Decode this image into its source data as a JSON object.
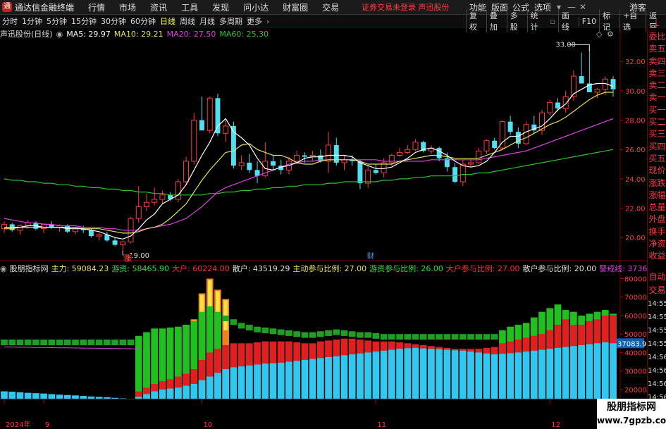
{
  "titlebar": {
    "app_name": "通达信金融终端",
    "menus": [
      "行情",
      "市场",
      "资讯",
      "工具",
      "发现",
      "问小达",
      "财富圈",
      "交易"
    ],
    "warning": "证券交易未登录  声迅股份",
    "right_menus": [
      "功能",
      "版面",
      "公式",
      "选项",
      "游客"
    ]
  },
  "toolbar": {
    "periods": [
      "分时",
      "1分钟",
      "5分钟",
      "15分钟",
      "30分钟",
      "60分钟",
      "日线",
      "周线",
      "月线",
      "多周期",
      "更多"
    ],
    "active_period": "日线",
    "right_buttons": [
      "复权",
      "叠加",
      "多股",
      "统计",
      "画线",
      "F10",
      "标记",
      "+自选",
      "返回"
    ]
  },
  "kline": {
    "stock": "声迅股份(日线)",
    "ma": [
      {
        "label": "MA5: 29.97",
        "color": "#ffffff"
      },
      {
        "label": "MA10: 29.21",
        "color": "#e8e05a"
      },
      {
        "label": "MA20: 27.50",
        "color": "#e040e0"
      },
      {
        "label": "MA60: 25.30",
        "color": "#30c030"
      }
    ],
    "price_ticks": [
      "32.00",
      "30.00",
      "28.00",
      "26.00",
      "24.00",
      "22.00",
      "20.00"
    ],
    "high_label": "33.00",
    "low_label": "19.00",
    "marker_zhang": "涨",
    "marker_cai": "财"
  },
  "indicator": {
    "name": "股朋指标网",
    "items": [
      {
        "label": "主力: 59084.23",
        "color": "#e8e05a"
      },
      {
        "label": "游资: 58465.90",
        "color": "#30e030"
      },
      {
        "label": "大户: 60224.00",
        "color": "#ff3030"
      },
      {
        "label": "散户: 43519.29",
        "color": "#dddddd"
      },
      {
        "label": "主动参与比例: 27.00",
        "color": "#e8e05a"
      },
      {
        "label": "游资参与比例: 26.00",
        "color": "#30e030"
      },
      {
        "label": "大户参与比例: 27.00",
        "color": "#ff3030"
      },
      {
        "label": "散户参与比例: 20.00",
        "color": "#dddddd"
      },
      {
        "label": "警戒线: 37367.96",
        "color": "#e040e0"
      }
    ],
    "value_ticks": [
      "80000",
      "70000",
      "60000",
      "50000",
      "40000",
      "30000",
      "20000"
    ],
    "current_value": "37083.96"
  },
  "time_axis": [
    "2024年",
    "9",
    "10",
    "11",
    "12"
  ],
  "right_panel": {
    "top_labels": [
      "委比",
      "卖五",
      "卖四",
      "卖三",
      "卖二",
      "卖一",
      "买一",
      "买二",
      "买三",
      "买四",
      "买五",
      "现价",
      "涨跌",
      "涨幅",
      "总量",
      "外盘",
      "换手",
      "净资",
      "收益"
    ],
    "bottom_labels": [
      "自动",
      "交易",
      "14:55",
      "14:55",
      "14:55",
      "14:55",
      "14:56",
      "14:56",
      "14:56",
      "14:56"
    ],
    "corner": "L"
  },
  "watermark": {
    "line1": "股朋指标网",
    "line2": "www.7gpzb.com"
  },
  "chart_data": {
    "type": "candlestick",
    "candles": [
      [
        20.6,
        21.1,
        20.3,
        20.9
      ],
      [
        20.9,
        21.0,
        20.4,
        20.5
      ],
      [
        20.5,
        20.9,
        20.2,
        20.8
      ],
      [
        20.8,
        21.2,
        20.6,
        21.0
      ],
      [
        21.0,
        21.1,
        20.5,
        20.6
      ],
      [
        20.6,
        21.0,
        20.3,
        20.9
      ],
      [
        20.9,
        21.1,
        20.6,
        20.7
      ],
      [
        20.7,
        20.9,
        20.4,
        20.8
      ],
      [
        20.8,
        20.9,
        20.3,
        20.4
      ],
      [
        20.4,
        20.7,
        20.2,
        20.6
      ],
      [
        20.6,
        20.8,
        20.3,
        20.5
      ],
      [
        20.5,
        20.6,
        20.0,
        20.1
      ],
      [
        20.1,
        20.3,
        19.8,
        20.2
      ],
      [
        20.2,
        20.4,
        19.7,
        19.8
      ],
      [
        19.8,
        20.0,
        19.4,
        19.5
      ],
      [
        19.5,
        19.8,
        19.0,
        19.7
      ],
      [
        19.7,
        21.4,
        19.6,
        21.3
      ],
      [
        21.3,
        23.5,
        21.0,
        22.1
      ],
      [
        22.1,
        23.0,
        21.8,
        22.4
      ],
      [
        22.4,
        23.4,
        22.2,
        22.6
      ],
      [
        22.6,
        23.2,
        22.3,
        22.9
      ],
      [
        22.9,
        23.1,
        22.5,
        22.6
      ],
      [
        22.6,
        24.0,
        22.4,
        23.8
      ],
      [
        23.8,
        25.5,
        23.6,
        25.2
      ],
      [
        25.2,
        28.5,
        25.0,
        28.0
      ],
      [
        28.0,
        29.6,
        27.5,
        27.3
      ],
      [
        27.3,
        29.6,
        27.1,
        29.5
      ],
      [
        29.5,
        29.8,
        26.9,
        27.1
      ],
      [
        27.1,
        28.0,
        26.5,
        27.6
      ],
      [
        27.6,
        27.9,
        24.7,
        24.9
      ],
      [
        24.9,
        25.6,
        24.6,
        25.1
      ],
      [
        25.1,
        25.7,
        24.4,
        24.6
      ],
      [
        24.6,
        25.2,
        23.7,
        24.2
      ],
      [
        24.2,
        26.5,
        24.1,
        25.2
      ],
      [
        25.2,
        25.6,
        24.6,
        24.9
      ],
      [
        24.9,
        25.3,
        24.3,
        24.6
      ],
      [
        24.6,
        25.5,
        24.3,
        25.2
      ],
      [
        25.2,
        25.9,
        25.0,
        25.6
      ],
      [
        25.6,
        25.8,
        25.1,
        25.5
      ],
      [
        25.5,
        25.9,
        25.2,
        25.6
      ],
      [
        25.6,
        26.0,
        25.1,
        25.2
      ],
      [
        25.2,
        27.2,
        24.4,
        26.3
      ],
      [
        26.3,
        26.8,
        24.9,
        25.1
      ],
      [
        25.1,
        25.6,
        24.6,
        25.3
      ],
      [
        25.3,
        25.6,
        24.9,
        25.2
      ],
      [
        25.2,
        25.3,
        23.3,
        23.7
      ],
      [
        23.7,
        24.9,
        23.4,
        24.6
      ],
      [
        24.6,
        25.0,
        24.3,
        24.4
      ],
      [
        24.4,
        25.4,
        24.1,
        25.1
      ],
      [
        25.1,
        25.7,
        24.9,
        25.6
      ],
      [
        25.6,
        26.1,
        25.5,
        25.8
      ],
      [
        25.8,
        26.3,
        25.7,
        26.0
      ],
      [
        26.0,
        26.7,
        25.9,
        26.5
      ],
      [
        26.5,
        26.6,
        25.8,
        25.9
      ],
      [
        25.9,
        26.3,
        25.7,
        26.1
      ],
      [
        26.1,
        26.2,
        25.2,
        25.4
      ],
      [
        25.4,
        25.8,
        24.5,
        24.8
      ],
      [
        24.8,
        25.1,
        23.7,
        23.8
      ],
      [
        23.8,
        25.3,
        23.5,
        25.0
      ],
      [
        25.0,
        25.3,
        24.8,
        25.1
      ],
      [
        25.1,
        26.1,
        25.0,
        25.9
      ],
      [
        25.9,
        26.7,
        25.7,
        26.6
      ],
      [
        26.6,
        26.8,
        26.0,
        26.1
      ],
      [
        26.1,
        28.0,
        26.0,
        27.9
      ],
      [
        27.9,
        28.3,
        27.0,
        27.2
      ],
      [
        27.2,
        27.5,
        26.1,
        26.4
      ],
      [
        26.4,
        27.9,
        26.3,
        27.7
      ],
      [
        27.7,
        28.3,
        27.1,
        27.3
      ],
      [
        27.3,
        28.7,
        27.0,
        28.5
      ],
      [
        28.5,
        29.4,
        28.3,
        29.2
      ],
      [
        29.2,
        29.5,
        28.6,
        28.8
      ],
      [
        28.8,
        30.0,
        28.5,
        29.6
      ],
      [
        29.6,
        31.4,
        29.3,
        31.0
      ],
      [
        31.0,
        32.6,
        30.8,
        30.5
      ],
      [
        30.5,
        33.0,
        30.2,
        29.9
      ],
      [
        29.9,
        30.2,
        29.5,
        30.1
      ],
      [
        30.1,
        31.0,
        29.7,
        30.8
      ],
      [
        30.8,
        31.0,
        29.6,
        30.1
      ]
    ],
    "ma5": [
      20.7,
      20.7,
      20.7,
      20.8,
      20.8,
      20.7,
      20.7,
      20.7,
      20.6,
      20.6,
      20.6,
      20.5,
      20.4,
      20.2,
      20.0,
      19.9,
      20.1,
      20.6,
      21.2,
      21.6,
      22.3,
      22.6,
      22.9,
      23.6,
      24.6,
      25.6,
      26.5,
      27.6,
      28.1,
      27.2,
      26.8,
      26.3,
      25.4,
      24.7,
      24.6,
      24.8,
      24.9,
      25.1,
      25.4,
      25.5,
      25.5,
      25.6,
      25.6,
      25.6,
      25.5,
      25.1,
      24.9,
      24.7,
      24.7,
      24.8,
      25.1,
      25.4,
      25.8,
      26.0,
      26.1,
      25.9,
      25.6,
      25.2,
      24.9,
      24.8,
      24.9,
      25.2,
      25.8,
      26.5,
      26.9,
      26.9,
      27.2,
      27.4,
      27.6,
      28.1,
      28.7,
      29.1,
      29.8,
      30.1,
      30.4,
      30.5,
      30.5,
      30.3
    ],
    "ma10": [
      20.6,
      20.6,
      20.7,
      20.7,
      20.7,
      20.7,
      20.7,
      20.7,
      20.7,
      20.7,
      20.6,
      20.6,
      20.6,
      20.5,
      20.4,
      20.3,
      20.3,
      20.4,
      20.6,
      20.7,
      20.9,
      21.3,
      21.8,
      22.3,
      23.1,
      23.9,
      24.6,
      25.2,
      25.8,
      25.9,
      26.3,
      26.4,
      26.0,
      25.8,
      25.6,
      25.6,
      25.4,
      25.1,
      25.0,
      25.0,
      25.2,
      25.3,
      25.3,
      25.3,
      25.3,
      25.2,
      25.0,
      25.0,
      25.0,
      25.0,
      25.2,
      25.3,
      25.4,
      25.5,
      25.6,
      25.6,
      25.5,
      25.4,
      25.4,
      25.4,
      25.4,
      25.6,
      25.8,
      26.0,
      26.3,
      26.6,
      26.8,
      27.1,
      27.4,
      27.7,
      27.9,
      28.2,
      28.6,
      29.0,
      29.4,
      29.7,
      29.9,
      29.9
    ],
    "ma20": [
      21.3,
      21.2,
      21.1,
      21.0,
      21.0,
      20.9,
      20.9,
      20.8,
      20.8,
      20.8,
      20.7,
      20.7,
      20.7,
      20.6,
      20.6,
      20.5,
      20.5,
      20.5,
      20.6,
      20.7,
      20.8,
      20.9,
      21.1,
      21.3,
      21.7,
      22.1,
      22.6,
      23.1,
      23.4,
      23.6,
      23.8,
      24.0,
      24.2,
      24.4,
      24.6,
      24.8,
      25.0,
      25.1,
      25.2,
      25.2,
      25.3,
      25.3,
      25.3,
      25.3,
      25.3,
      25.3,
      25.3,
      25.3,
      25.2,
      25.2,
      25.2,
      25.2,
      25.2,
      25.2,
      25.3,
      25.3,
      25.3,
      25.3,
      25.3,
      25.3,
      25.3,
      25.4,
      25.5,
      25.6,
      25.7,
      25.8,
      25.9,
      26.1,
      26.3,
      26.5,
      26.7,
      26.9,
      27.1,
      27.3,
      27.5,
      27.7,
      27.9,
      28.1
    ],
    "ma60": [
      24.0,
      23.9,
      23.9,
      23.8,
      23.8,
      23.7,
      23.7,
      23.6,
      23.6,
      23.5,
      23.5,
      23.4,
      23.4,
      23.3,
      23.3,
      23.2,
      23.2,
      23.1,
      23.1,
      23.0,
      23.0,
      22.9,
      22.9,
      22.9,
      22.9,
      22.9,
      23.0,
      23.0,
      23.1,
      23.1,
      23.2,
      23.2,
      23.3,
      23.3,
      23.4,
      23.4,
      23.5,
      23.5,
      23.6,
      23.6,
      23.6,
      23.7,
      23.7,
      23.8,
      23.8,
      23.8,
      23.8,
      23.8,
      23.9,
      23.9,
      24.0,
      24.0,
      24.1,
      24.1,
      24.2,
      24.2,
      24.2,
      24.2,
      24.3,
      24.3,
      24.4,
      24.4,
      24.5,
      24.6,
      24.7,
      24.8,
      24.9,
      25.0,
      25.1,
      25.2,
      25.3,
      25.4,
      25.5,
      25.6,
      25.7,
      25.8,
      25.9,
      26.0
    ],
    "price_ylim": [
      19.0,
      33.5
    ],
    "ind": {
      "cyan": [
        19000,
        18800,
        18500,
        18200,
        18000,
        17800,
        17500,
        17200,
        17000,
        16800,
        16500,
        16200,
        16000,
        15800,
        15500,
        15200,
        15000,
        16000,
        17500,
        19000,
        20000,
        20500,
        21000,
        22000,
        23000,
        25000,
        27000,
        29000,
        31000,
        32000,
        32500,
        33000,
        33500,
        34000,
        34200,
        34500,
        35000,
        35500,
        36000,
        36500,
        37000,
        37500,
        38000,
        38500,
        39000,
        39500,
        40000,
        40500,
        41000,
        41500,
        42000,
        42300,
        42500,
        42200,
        42000,
        41800,
        41500,
        41200,
        41000,
        40500,
        40000,
        39500,
        39000,
        39300,
        39600,
        40000,
        40500,
        41000,
        41500,
        42000,
        42500,
        43000,
        43500,
        44000,
        44500,
        45000,
        45500,
        45000
      ],
      "red": [
        0,
        0,
        0,
        0,
        0,
        0,
        0,
        0,
        0,
        0,
        0,
        0,
        0,
        0,
        0,
        0,
        0,
        19000,
        21000,
        23000,
        24500,
        25500,
        27000,
        28500,
        31000,
        36000,
        40000,
        42000,
        44000,
        45000,
        45000,
        45000,
        45500,
        46000,
        46000,
        46000,
        46000,
        45500,
        45000,
        45000,
        46000,
        46500,
        47000,
        47500,
        47500,
        47000,
        46500,
        46000,
        46000,
        46000,
        45500,
        45000,
        44500,
        44000,
        43500,
        43000,
        42500,
        42000,
        42000,
        42000,
        42000,
        42500,
        43000,
        45000,
        46000,
        47000,
        48000,
        49000,
        50000,
        52000,
        55000,
        58000,
        55000,
        55000,
        57000,
        58000,
        60000,
        60200
      ],
      "green": [
        47000,
        47000,
        47000,
        47000,
        47000,
        47000,
        47000,
        47000,
        47000,
        47000,
        47000,
        47000,
        47000,
        47000,
        47000,
        47000,
        47000,
        49000,
        51000,
        53000,
        53000,
        53500,
        54000,
        55000,
        57000,
        62000,
        65000,
        62000,
        60000,
        58000,
        56000,
        55000,
        54000,
        53500,
        53000,
        52500,
        52000,
        51500,
        51000,
        51000,
        51500,
        52000,
        52500,
        52000,
        51500,
        51000,
        51000,
        50500,
        50000,
        50000,
        50000,
        50000,
        50000,
        50000,
        50000,
        50000,
        50000,
        50000,
        50000,
        50000,
        50000,
        50000,
        50000,
        52000,
        54000,
        55000,
        56000,
        59000,
        62000,
        64000,
        66000,
        63000,
        62000,
        60000,
        61000,
        62000,
        63000,
        61000
      ],
      "yellow": [
        0,
        0,
        0,
        0,
        0,
        0,
        0,
        0,
        0,
        0,
        0,
        0,
        0,
        0,
        0,
        0,
        0,
        36000,
        42000,
        47000,
        49000,
        50000,
        52000,
        55000,
        58000,
        72000,
        80000,
        74000,
        69000,
        0,
        0,
        0,
        0,
        0,
        0,
        0,
        0,
        0,
        0,
        0,
        0,
        0,
        0,
        0,
        0,
        0,
        0,
        0,
        0,
        0,
        0,
        0,
        0,
        0,
        0,
        0,
        0,
        0,
        0,
        0,
        0,
        0,
        0,
        0,
        0,
        0,
        0,
        0,
        0,
        0,
        0,
        0,
        0,
        0,
        0,
        0,
        0,
        0
      ],
      "ind_ylim": [
        15000,
        84000
      ]
    }
  }
}
